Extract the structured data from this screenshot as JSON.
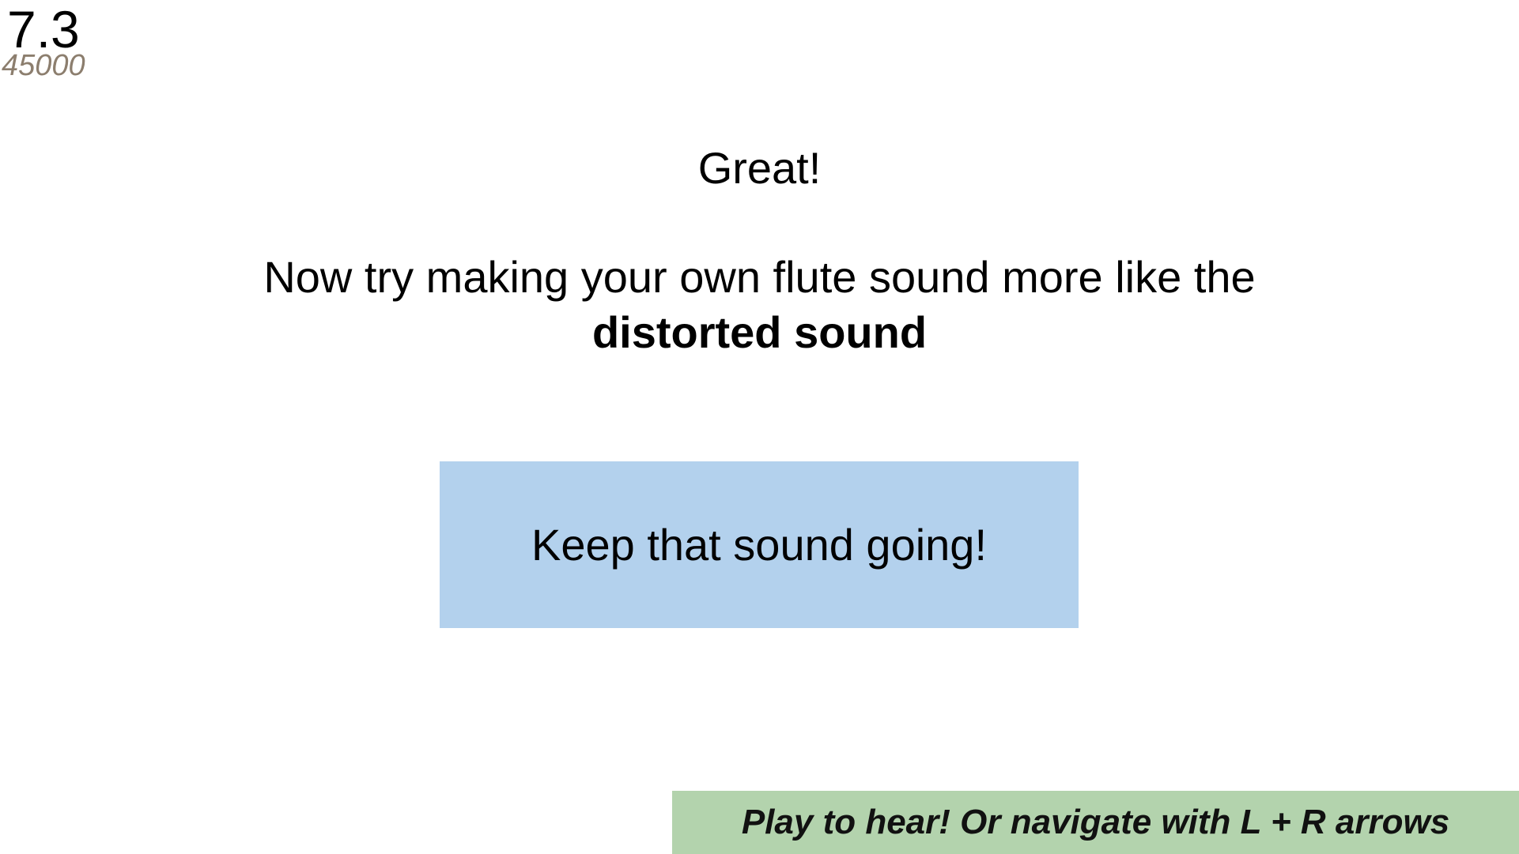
{
  "header": {
    "version": "7.3",
    "counter": "45000"
  },
  "main": {
    "heading": "Great!",
    "instruction_text": "Now try making your own flute sound more like the",
    "instruction_emphasis": "distorted sound",
    "status_message": "Keep that sound going!"
  },
  "footer": {
    "hint": "Play to hear! Or navigate with L + R arrows"
  },
  "colors": {
    "status_box": "#b3d1ed",
    "hint_bar": "#b3d3ad",
    "counter_text": "#8c7e6e"
  }
}
